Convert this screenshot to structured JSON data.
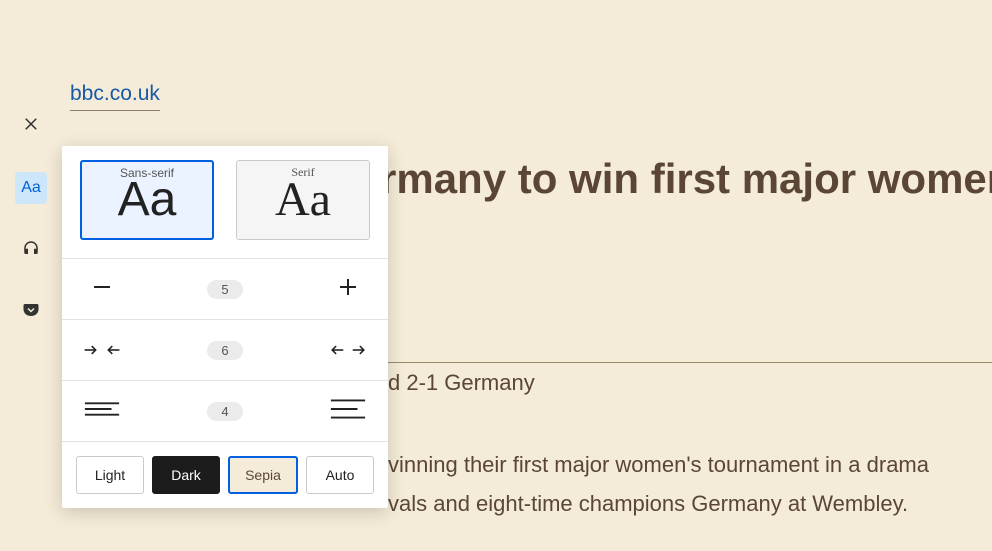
{
  "site": {
    "domain": "bbc.co.uk"
  },
  "article": {
    "title": "rmany to win first major women'",
    "scoreline": "d 2-1 Germany",
    "body_line1": "vinning their first major women's tournament in a drama",
    "body_line2": "vals and eight-time champions Germany at Wembley."
  },
  "panel": {
    "font_sans_label": "Sans-serif",
    "font_serif_label": "Serif",
    "font_sample": "Aa",
    "font_size_value": "5",
    "content_width_value": "6",
    "line_height_value": "4",
    "themes": {
      "light": "Light",
      "dark": "Dark",
      "sepia": "Sepia",
      "auto": "Auto"
    }
  },
  "toolbar": {
    "aa_label": "Aa"
  }
}
